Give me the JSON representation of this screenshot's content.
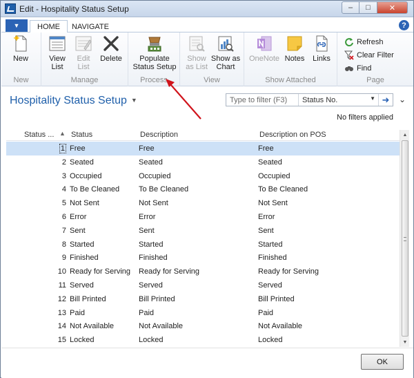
{
  "window": {
    "title": "Edit - Hospitality Status Setup",
    "controls": {
      "minimize": "–",
      "maximize": "□",
      "close": "✕"
    }
  },
  "ribbon_tabs": {
    "file_menu": "▼",
    "tabs": [
      {
        "label": "HOME",
        "active": true
      },
      {
        "label": "NAVIGATE",
        "active": false
      }
    ],
    "help": "?"
  },
  "ribbon": {
    "groups": [
      {
        "label": "New",
        "buttons": [
          {
            "label": "New",
            "icon": "new-document-icon",
            "enabled": true
          }
        ]
      },
      {
        "label": "Manage",
        "buttons": [
          {
            "label": "View List",
            "icon": "view-list-icon",
            "enabled": true
          },
          {
            "label": "Edit List",
            "icon": "edit-list-icon",
            "enabled": false
          },
          {
            "label": "Delete",
            "icon": "delete-icon",
            "enabled": true
          }
        ]
      },
      {
        "label": "Process",
        "buttons": [
          {
            "label": "Populate Status Setup",
            "icon": "populate-status-icon",
            "enabled": true
          }
        ]
      },
      {
        "label": "View",
        "buttons": [
          {
            "label": "Show as List",
            "icon": "show-as-list-icon",
            "enabled": false
          },
          {
            "label": "Show as Chart",
            "icon": "show-as-chart-icon",
            "enabled": true
          }
        ]
      },
      {
        "label": "Show Attached",
        "buttons": [
          {
            "label": "OneNote",
            "icon": "onenote-icon",
            "enabled": false
          },
          {
            "label": "Notes",
            "icon": "notes-icon",
            "enabled": true
          },
          {
            "label": "Links",
            "icon": "links-icon",
            "enabled": true
          }
        ]
      },
      {
        "label": "Page",
        "buttons": [
          {
            "label": "Refresh",
            "icon": "refresh-icon",
            "enabled": true
          },
          {
            "label": "Clear Filter",
            "icon": "clear-filter-icon",
            "enabled": true
          },
          {
            "label": "Find",
            "icon": "find-icon",
            "enabled": true
          }
        ]
      }
    ]
  },
  "page": {
    "title": "Hospitality Status Setup",
    "filter": {
      "placeholder": "Type to filter (F3)",
      "field": "Status No.",
      "no_filters": "No filters applied"
    }
  },
  "grid": {
    "columns": [
      "Status ...",
      "Status",
      "Description",
      "Description on POS"
    ],
    "rows": [
      {
        "no": "1",
        "status": "Free",
        "description": "Free",
        "pos": "Free",
        "selected": true
      },
      {
        "no": "2",
        "status": "Seated",
        "description": "Seated",
        "pos": "Seated"
      },
      {
        "no": "3",
        "status": "Occupied",
        "description": "Occupied",
        "pos": "Occupied"
      },
      {
        "no": "4",
        "status": "To Be Cleaned",
        "description": "To Be Cleaned",
        "pos": "To Be Cleaned"
      },
      {
        "no": "5",
        "status": "Not Sent",
        "description": "Not Sent",
        "pos": "Not Sent"
      },
      {
        "no": "6",
        "status": "Error",
        "description": "Error",
        "pos": "Error"
      },
      {
        "no": "7",
        "status": "Sent",
        "description": "Sent",
        "pos": "Sent"
      },
      {
        "no": "8",
        "status": "Started",
        "description": "Started",
        "pos": "Started"
      },
      {
        "no": "9",
        "status": "Finished",
        "description": "Finished",
        "pos": "Finished"
      },
      {
        "no": "10",
        "status": "Ready for Serving",
        "description": "Ready for Serving",
        "pos": "Ready for Serving"
      },
      {
        "no": "11",
        "status": "Served",
        "description": "Served",
        "pos": "Served"
      },
      {
        "no": "12",
        "status": "Bill Printed",
        "description": "Bill Printed",
        "pos": "Bill Printed"
      },
      {
        "no": "13",
        "status": "Paid",
        "description": "Paid",
        "pos": "Paid"
      },
      {
        "no": "14",
        "status": "Not Available",
        "description": "Not Available",
        "pos": "Not Available"
      },
      {
        "no": "15",
        "status": "Locked",
        "description": "Locked",
        "pos": "Locked"
      }
    ]
  },
  "footer": {
    "ok": "OK"
  },
  "colors": {
    "accent": "#1f5faa",
    "selection": "#cde1f7",
    "annotation_arrow": "#d0141c"
  }
}
